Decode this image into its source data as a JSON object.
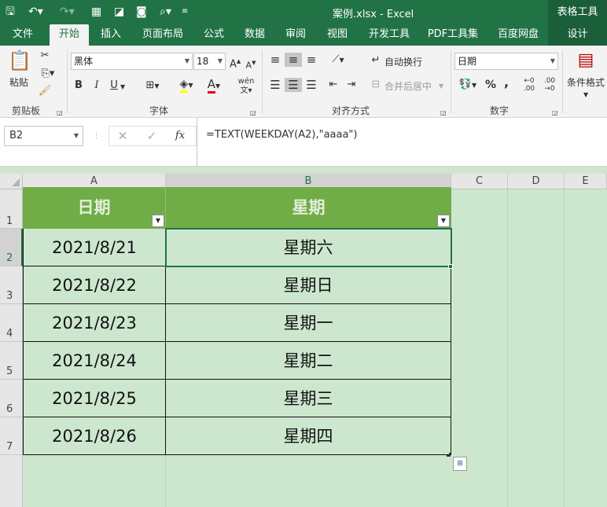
{
  "title": {
    "filename": "案例.xlsx - Excel",
    "context_group": "表格工具"
  },
  "tabs": [
    "文件",
    "开始",
    "插入",
    "页面布局",
    "公式",
    "数据",
    "审阅",
    "视图",
    "开发工具",
    "PDF工具集",
    "百度网盘",
    "设计"
  ],
  "ribbon": {
    "clipboard": {
      "paste": "粘贴",
      "label": "剪贴板"
    },
    "font": {
      "name": "黑体",
      "size": "18",
      "label": "字体",
      "bold": "B",
      "italic": "I",
      "underline": "U"
    },
    "alignment": {
      "wrap": "自动换行",
      "merge": "合并后居中",
      "label": "对齐方式"
    },
    "number": {
      "format": "日期",
      "label": "数字",
      "percent": "%",
      "comma": ","
    },
    "styles": {
      "conditional": "条件格式"
    }
  },
  "formula_bar": {
    "name_box": "B2",
    "formula": "=TEXT(WEEKDAY(A2),\"aaaa\")",
    "fx": "fx"
  },
  "columns": [
    "A",
    "B",
    "C",
    "D",
    "E"
  ],
  "rows": [
    "1",
    "2",
    "3",
    "4",
    "5",
    "6",
    "7"
  ],
  "table": {
    "headers": [
      "日期",
      "星期"
    ],
    "rows": [
      [
        "2021/8/21",
        "星期六"
      ],
      [
        "2021/8/22",
        "星期日"
      ],
      [
        "2021/8/23",
        "星期一"
      ],
      [
        "2021/8/24",
        "星期二"
      ],
      [
        "2021/8/25",
        "星期三"
      ],
      [
        "2021/8/26",
        "星期四"
      ]
    ]
  },
  "colors": {
    "excel_green": "#217346",
    "header_fill": "#70ad47",
    "cell_fill": "#cde7cf"
  }
}
